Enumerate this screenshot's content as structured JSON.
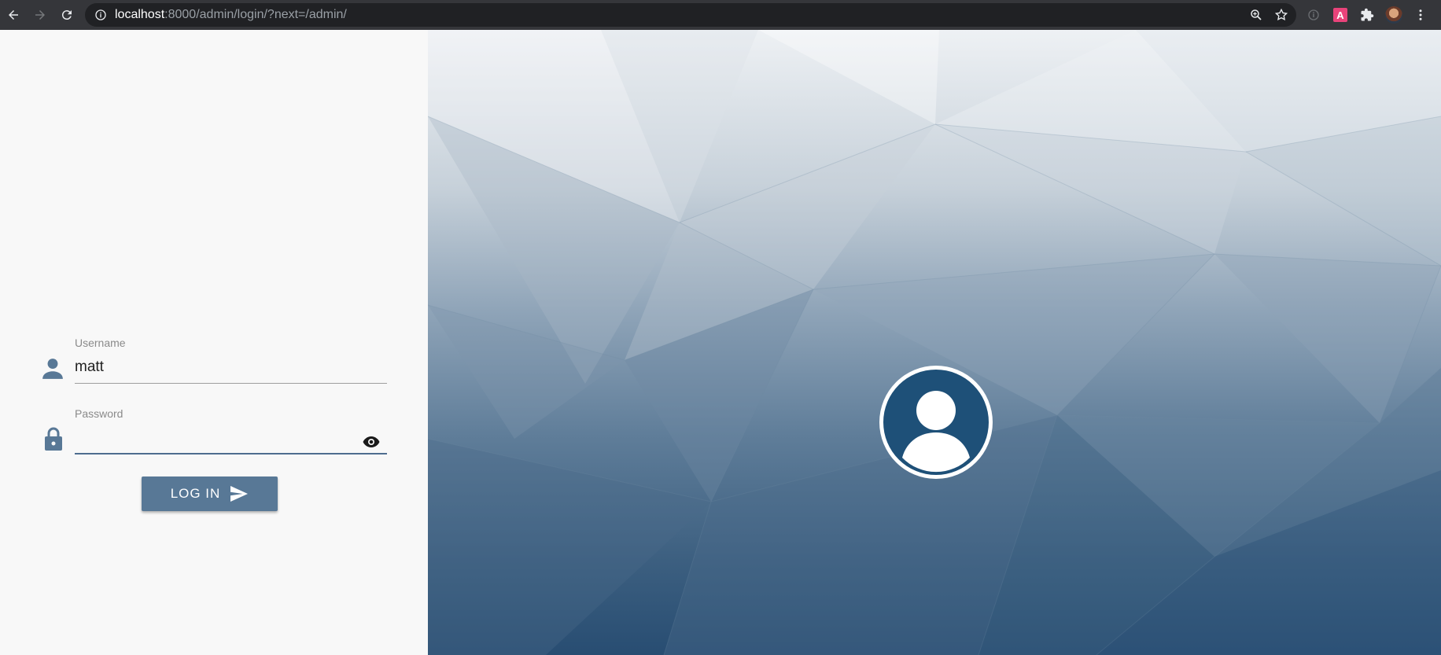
{
  "browser": {
    "url_host": "localhost",
    "url_path": ":8000/admin/login/?next=/admin/",
    "extension_badge": "A"
  },
  "login": {
    "username_label": "Username",
    "username_value": "matt",
    "password_label": "Password",
    "password_value": "",
    "login_button": "LOG IN"
  },
  "colors": {
    "accent": "#587896",
    "avatar_bg": "#1e5078"
  },
  "icons": {
    "user": "person-icon",
    "password": "lock-icon",
    "reveal": "eye-icon",
    "submit": "send-icon"
  }
}
